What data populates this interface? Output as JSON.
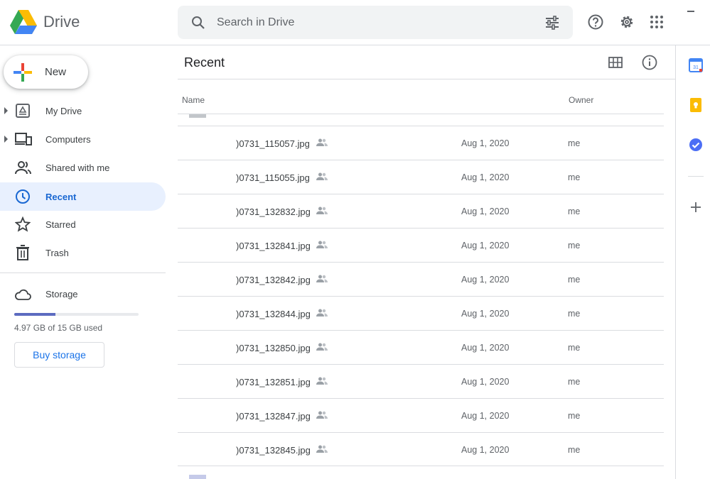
{
  "header": {
    "brand": "Drive",
    "search_placeholder": "Search in Drive",
    "icons": [
      "search-icon",
      "tune-icon",
      "help-icon",
      "settings-icon",
      "apps-icon"
    ]
  },
  "sidebar": {
    "new_label": "New",
    "items": [
      {
        "label": "My Drive",
        "icon": "my-drive-icon",
        "expandable": true,
        "active": false
      },
      {
        "label": "Computers",
        "icon": "computers-icon",
        "expandable": true,
        "active": false
      },
      {
        "label": "Shared with me",
        "icon": "shared-with-me-icon",
        "expandable": false,
        "active": false
      },
      {
        "label": "Recent",
        "icon": "recent-icon",
        "expandable": false,
        "active": true
      },
      {
        "label": "Starred",
        "icon": "star-icon",
        "expandable": false,
        "active": false
      },
      {
        "label": "Trash",
        "icon": "trash-icon",
        "expandable": false,
        "active": false
      }
    ],
    "storage": {
      "label": "Storage",
      "used_text": "4.97 GB of 15 GB used",
      "used_fraction": 0.331,
      "buy_label": "Buy storage"
    }
  },
  "main": {
    "title": "Recent",
    "columns": {
      "name": "Name",
      "owner": "Owner"
    },
    "rows": [
      {
        "name": ")0731_115057.jpg",
        "date": "Aug 1, 2020",
        "owner": "me"
      },
      {
        "name": ")0731_115055.jpg",
        "date": "Aug 1, 2020",
        "owner": "me"
      },
      {
        "name": ")0731_132832.jpg",
        "date": "Aug 1, 2020",
        "owner": "me"
      },
      {
        "name": ")0731_132841.jpg",
        "date": "Aug 1, 2020",
        "owner": "me"
      },
      {
        "name": ")0731_132842.jpg",
        "date": "Aug 1, 2020",
        "owner": "me"
      },
      {
        "name": ")0731_132844.jpg",
        "date": "Aug 1, 2020",
        "owner": "me"
      },
      {
        "name": ")0731_132850.jpg",
        "date": "Aug 1, 2020",
        "owner": "me"
      },
      {
        "name": ")0731_132851.jpg",
        "date": "Aug 1, 2020",
        "owner": "me"
      },
      {
        "name": ")0731_132847.jpg",
        "date": "Aug 1, 2020",
        "owner": "me"
      },
      {
        "name": ")0731_132845.jpg",
        "date": "Aug 1, 2020",
        "owner": "me"
      }
    ]
  },
  "side_panel": {
    "icons": [
      "calendar-icon",
      "keep-icon",
      "tasks-icon",
      "add-icon"
    ],
    "calendar_day": "31"
  },
  "colors": {
    "active_bg": "#e8f0fe",
    "active_text": "#1967d2",
    "link_blue": "#1a73e8",
    "storage_fill": "#5c6bc0",
    "keep_yellow": "#fbbc04",
    "tasks_blue": "#4c6ef5"
  }
}
